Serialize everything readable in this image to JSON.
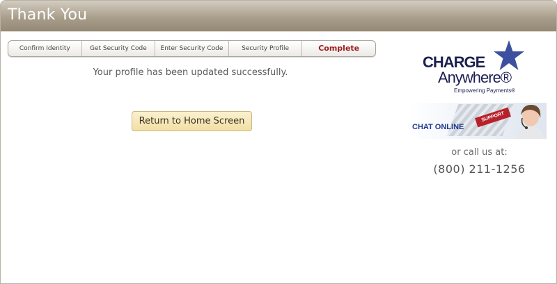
{
  "header": {
    "title": "Thank You"
  },
  "steps": [
    {
      "label": "Confirm Identity"
    },
    {
      "label": "Get Security Code"
    },
    {
      "label": "Enter Security Code"
    },
    {
      "label": "Security Profile"
    },
    {
      "label": "Complete",
      "active": true
    }
  ],
  "main": {
    "message": "Your profile has been updated successfully.",
    "home_button": "Return to Home Screen"
  },
  "sidebar": {
    "logo": {
      "line1": "CHARGE",
      "line2": "Anywhere®",
      "tagline": "Empowering Payments®"
    },
    "chat": {
      "label": "CHAT ONLINE",
      "tag": "SUPPORT"
    },
    "call_text": "or call us at:",
    "phone": "(800) 211-1256"
  },
  "colors": {
    "brand_navy": "#1b2050",
    "star_blue": "#3d4f9f",
    "complete_red": "#9c1c1c",
    "button_fill": "#f1dfa4"
  }
}
